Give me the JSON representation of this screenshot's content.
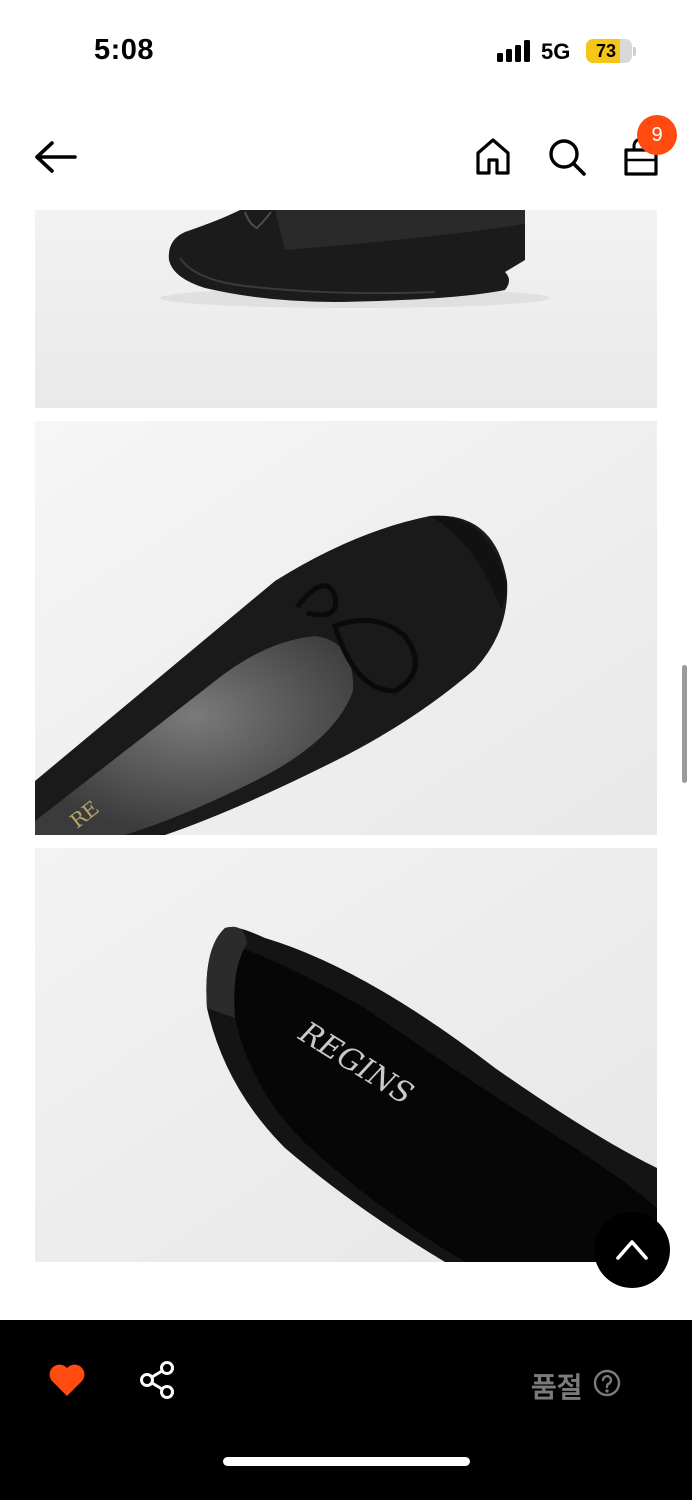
{
  "status_bar": {
    "time": "5:08",
    "network": "5G",
    "battery_level": "73",
    "battery_fraction": 0.73,
    "battery_color": "#f5c518"
  },
  "nav": {
    "icons": [
      "back-arrow-icon",
      "home-icon",
      "search-icon",
      "shopping-bag-icon"
    ],
    "cart_count": "9",
    "badge_color": "#ff4b0f"
  },
  "gallery": {
    "images": [
      {
        "alt": "ballet-flat-side-view",
        "bg": "#f0f0f0"
      },
      {
        "alt": "ballet-flat-toe-closeup",
        "bg": "#f1f1f1"
      },
      {
        "alt": "ballet-flat-heel-insole",
        "bg": "#efefef"
      }
    ],
    "insole_brand": "REGINS"
  },
  "bottom_bar": {
    "like_icon": "heart-icon",
    "like_color": "#ff4b0f",
    "share_icon": "share-icon",
    "status_label": "품절",
    "help_icon": "question-circle-icon"
  }
}
